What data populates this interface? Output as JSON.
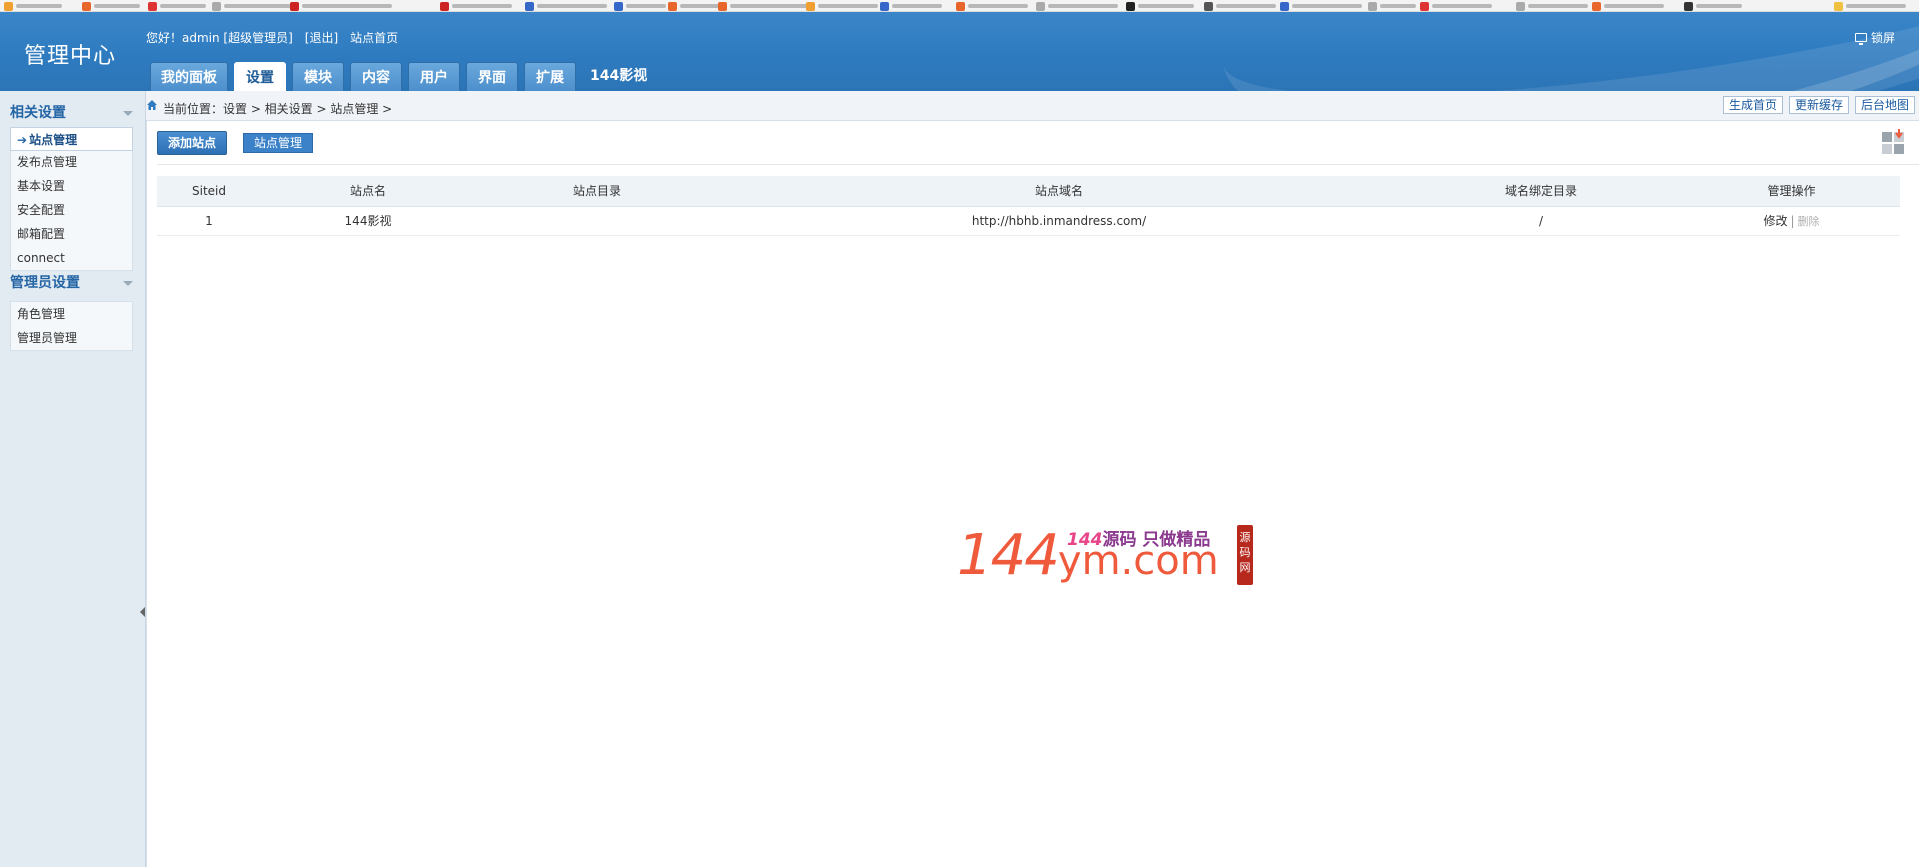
{
  "header": {
    "logo": "管理中心",
    "welcome": "您好！admin [超级管理员]",
    "logout": "[退出]",
    "site_home": "站点首页",
    "lock_screen": "锁屏"
  },
  "nav": {
    "tabs": [
      {
        "label": "我的面板"
      },
      {
        "label": "设置"
      },
      {
        "label": "模块"
      },
      {
        "label": "内容"
      },
      {
        "label": "用户"
      },
      {
        "label": "界面"
      },
      {
        "label": "扩展"
      }
    ],
    "active_tab": "设置",
    "site_label": "144影视"
  },
  "sidebar": {
    "groups": [
      {
        "title": "相关设置",
        "items": [
          {
            "label": "站点管理",
            "active": true
          },
          {
            "label": "发布点管理"
          },
          {
            "label": "基本设置"
          },
          {
            "label": "安全配置"
          },
          {
            "label": "邮箱配置"
          },
          {
            "label": "connect"
          }
        ]
      },
      {
        "title": "管理员设置",
        "items": [
          {
            "label": "角色管理"
          },
          {
            "label": "管理员管理"
          }
        ]
      }
    ]
  },
  "breadcrumb": "当前位置：设置 > 相关设置 > 站点管理 >",
  "toplinks": [
    "生成首页",
    "更新缓存",
    "后台地图"
  ],
  "subbar": {
    "add_site": "添加站点",
    "site_manage": "站点管理"
  },
  "table": {
    "headers": [
      "Siteid",
      "站点名",
      "站点目录",
      "站点域名",
      "域名绑定目录",
      "管理操作"
    ],
    "rows": [
      {
        "siteid": "1",
        "name": "144影视",
        "dir": "",
        "domain": "http://hbhb.inmandress.com/",
        "bind_dir": "/",
        "edit": "修改",
        "sep": "|",
        "delete": "删除"
      }
    ]
  },
  "watermark": {
    "big": "144",
    "ym": "ym.com",
    "slogan_num": "144",
    "slogan": "源码 只做精品",
    "seal": "源码网"
  },
  "colors": {
    "header_blue": "#2f7bc0",
    "sidebar_bg": "#e3ebf2",
    "link_blue": "#1b5ba0",
    "watermark_red": "#f05a3c"
  }
}
